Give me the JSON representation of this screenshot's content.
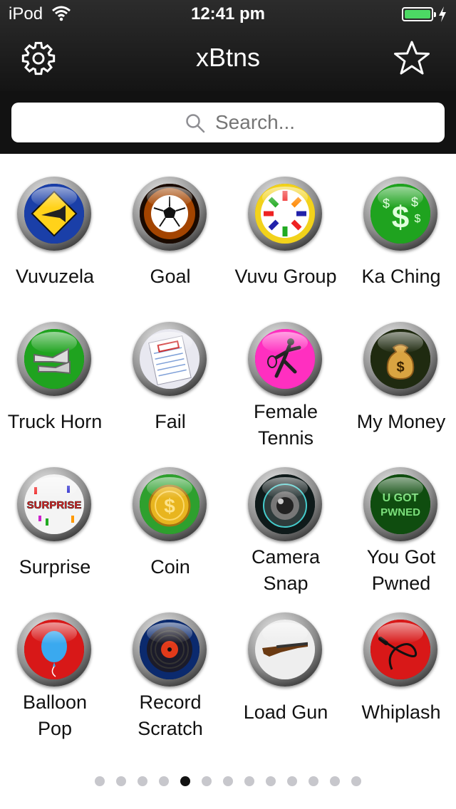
{
  "status": {
    "carrier": "iPod",
    "time": "12:41 pm",
    "battery_level": 1.0,
    "battery_color": "#4cd964"
  },
  "nav": {
    "title": "xBtns",
    "left_icon": "gear-icon",
    "right_icon": "star-icon"
  },
  "search": {
    "placeholder": "Search...",
    "icon": "search-icon"
  },
  "buttons": [
    {
      "label": "Vuvuzela",
      "icon": "vuvuzela-sign-icon",
      "face": "#1a3fa8"
    },
    {
      "label": "Goal",
      "icon": "soccer-ball-icon",
      "face": "#1a0a00"
    },
    {
      "label": "Vuvu Group",
      "icon": "vuvuzela-group-icon",
      "face": "#f2d21b"
    },
    {
      "label": "Ka Ching",
      "icon": "dollar-signs-icon",
      "face": "#1fa31f"
    },
    {
      "label": "Truck Horn",
      "icon": "air-horn-icon",
      "face": "#1fa31f"
    },
    {
      "label": "Fail",
      "icon": "failed-paper-icon",
      "face": "#e8e8f0"
    },
    {
      "label": "Female Tennis",
      "icon": "tennis-player-icon",
      "face": "#ff2fc0"
    },
    {
      "label": "My Money",
      "icon": "money-bag-icon",
      "face": "#1f2a10"
    },
    {
      "label": "Surprise",
      "icon": "surprise-confetti-icon",
      "face": "#f4f4f4"
    },
    {
      "label": "Coin",
      "icon": "gold-coin-icon",
      "face": "#2ea02e"
    },
    {
      "label": "Camera Snap",
      "icon": "camera-lens-icon",
      "face": "#0f1a1a"
    },
    {
      "label": "You Got Pwned",
      "icon": "pwned-text-icon",
      "face": "#0f4d0f",
      "face_text": "U GOT PWNED"
    },
    {
      "label": "Balloon Pop",
      "icon": "balloon-icon",
      "face": "#d81818"
    },
    {
      "label": "Record Scratch",
      "icon": "vinyl-record-icon",
      "face": "#0b2a6e"
    },
    {
      "label": "Load Gun",
      "icon": "shotgun-icon",
      "face": "#eeeeee"
    },
    {
      "label": "Whiplash",
      "icon": "whip-icon",
      "face": "#d81818"
    }
  ],
  "pager": {
    "pages": 13,
    "current": 5
  }
}
